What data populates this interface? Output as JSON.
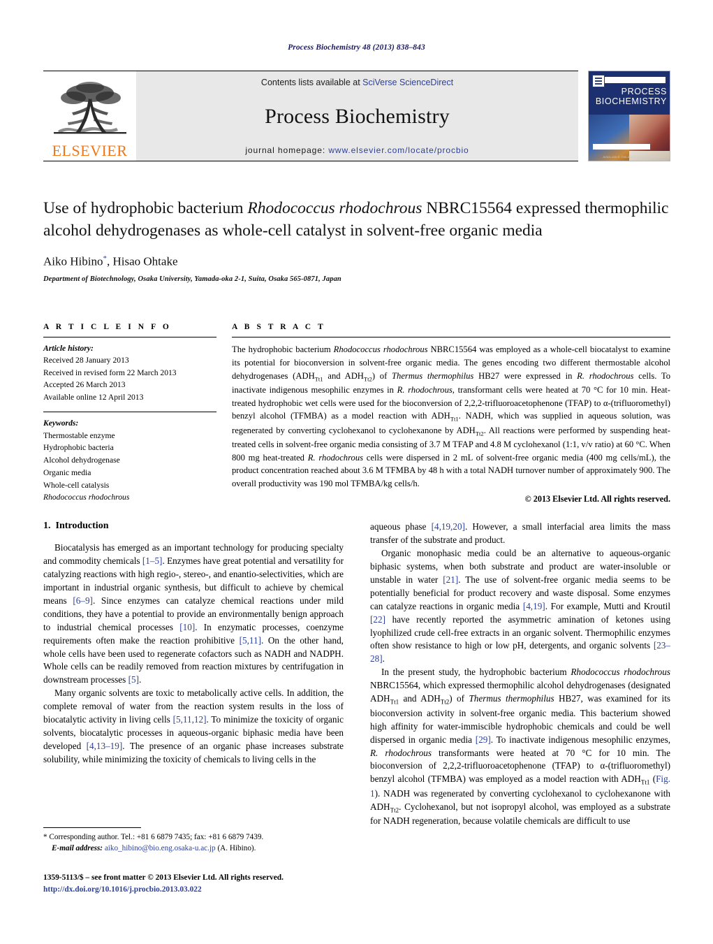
{
  "running_head": "Process Biochemistry 48 (2013) 838–843",
  "masthead": {
    "elsevier_wordmark": "ELSEVIER",
    "contents_prefix": "Contents lists available at ",
    "sciencedirect_link": "SciVerse ScienceDirect",
    "journal_title": "Process Biochemistry",
    "homepage_prefix": "journal homepage: ",
    "homepage_url": "www.elsevier.com/locate/procbio",
    "cover_title_line1": "PROCESS",
    "cover_title_line2": "BIOCHEMISTRY",
    "cover_footer": "AVAILABLE ONLINE AT SCIENCEDIRECT"
  },
  "article": {
    "title_part1": "Use of hydrophobic bacterium ",
    "title_species": "Rhodococcus rhodochrous",
    "title_part2": " NBRC15564 expressed thermophilic alcohol dehydrogenases as whole-cell catalyst in solvent-free organic media",
    "authors": "Aiko Hibino",
    "author_marker": "*",
    "authors_rest": ", Hisao Ohtake",
    "affiliation": "Department of Biotechnology, Osaka University, Yamada-oka 2-1, Suita, Osaka 565-0871, Japan"
  },
  "article_info": {
    "heading": "A R T I C L E  I N F O",
    "history_label": "Article history:",
    "history": [
      "Received 28 January 2013",
      "Received in revised form 22 March 2013",
      "Accepted 26 March 2013",
      "Available online 12 April 2013"
    ],
    "keywords_label": "Keywords:",
    "keywords": [
      "Thermostable enzyme",
      "Hydrophobic bacteria",
      "Alcohol dehydrogenase",
      "Organic media",
      "Whole-cell catalysis"
    ],
    "keyword_italic": "Rhodococcus rhodochrous"
  },
  "abstract": {
    "heading": "A B S T R A C T",
    "p1": "The hydrophobic bacterium ",
    "sp1": "Rhodococcus rhodochrous",
    "p2": " NBRC15564 was employed as a whole-cell biocatalyst to examine its potential for bioconversion in solvent-free organic media. The genes encoding two different thermostable alcohol dehydrogenases (ADH",
    "sub1": "Tt1",
    "p3": " and ADH",
    "sub2": "Tt2",
    "p4": ") of ",
    "sp2": "Thermus thermophilus",
    "p5": " HB27 were expressed in ",
    "sp3": "R. rhodochrous",
    "p6": " cells. To inactivate indigenous mesophilic enzymes in ",
    "sp4": "R. rhodochrous",
    "p7": ", transformant cells were heated at 70 °C for 10 min. Heat-treated hydrophobic wet cells were used for the bioconversion of 2,2,2-trifluoroacetophenone (TFAP) to α-(trifluoromethyl) benzyl alcohol (TFMBA) as a model reaction with ADH",
    "sub3": "Tt1",
    "p8": ". NADH, which was supplied in aqueous solution, was regenerated by converting cyclohexanol to cyclohexanone by ADH",
    "sub4": "Tt2",
    "p9": ". All reactions were performed by suspending heat-treated cells in solvent-free organic media consisting of 3.7 M TFAP and 4.8 M cyclohexanol (1:1, v/v ratio) at 60 °C. When 800 mg heat-treated ",
    "sp5": "R. rhodochrous",
    "p10": " cells were dispersed in 2 mL of solvent-free organic media (400 mg cells/mL), the product concentration reached about 3.6 M TFMBA by 48 h with a total NADH turnover number of approximately 900. The overall productivity was 190 mol TFMBA/kg cells/h.",
    "copyright": "© 2013 Elsevier Ltd. All rights reserved."
  },
  "introduction": {
    "number": "1.",
    "title": "Introduction",
    "left_p1_a": "Biocatalysis has emerged as an important technology for producing specialty and commodity chemicals ",
    "left_p1_r1": "[1–5]",
    "left_p1_b": ". Enzymes have great potential and versatility for catalyzing reactions with high regio-, stereo-, and enantio-selectivities, which are important in industrial organic synthesis, but difficult to achieve by chemical means ",
    "left_p1_r2": "[6–9]",
    "left_p1_c": ". Since enzymes can catalyze chemical reactions under mild conditions, they have a potential to provide an environmentally benign approach to industrial chemical processes ",
    "left_p1_r3": "[10]",
    "left_p1_d": ". In enzymatic processes, coenzyme requirements often make the reaction prohibitive ",
    "left_p1_r4": "[5,11]",
    "left_p1_e": ". On the other hand, whole cells have been used to regenerate cofactors such as NADH and NADPH. Whole cells can be readily removed from reaction mixtures by centrifugation in downstream processes ",
    "left_p1_r5": "[5]",
    "left_p1_f": ".",
    "left_p2_a": "Many organic solvents are toxic to metabolically active cells. In addition, the complete removal of water from the reaction system results in the loss of biocatalytic activity in living cells ",
    "left_p2_r1": "[5,11,12]",
    "left_p2_b": ". To minimize the toxicity of organic solvents, biocatalytic processes in aqueous-organic biphasic media have been developed ",
    "left_p2_r2": "[4,13–19]",
    "left_p2_c": ". The presence of an organic phase increases substrate solubility, while minimizing the toxicity of chemicals to living cells in the",
    "right_p1_a": "aqueous phase ",
    "right_p1_r1": "[4,19,20]",
    "right_p1_b": ". However, a small interfacial area limits the mass transfer of the substrate and product.",
    "right_p2_a": "Organic monophasic media could be an alternative to aqueous-organic biphasic systems, when both substrate and product are water-insoluble or unstable in water ",
    "right_p2_r1": "[21]",
    "right_p2_b": ". The use of solvent-free organic media seems to be potentially beneficial for product recovery and waste disposal. Some enzymes can catalyze reactions in organic media ",
    "right_p2_r2": "[4,19]",
    "right_p2_c": ". For example, Mutti and Kroutil ",
    "right_p2_r3": "[22]",
    "right_p2_d": " have recently reported the asymmetric amination of ketones using lyophilized crude cell-free extracts in an organic solvent. Thermophilic enzymes often show resistance to high or low pH, detergents, and organic solvents ",
    "right_p2_r4": "[23–28]",
    "right_p2_e": ".",
    "right_p3_a": "In the present study, the hydrophobic bacterium ",
    "right_p3_sp1": "Rhodococcus rhodochrous",
    "right_p3_b": " NBRC15564, which expressed thermophilic alcohol dehydrogenases (designated ADH",
    "right_p3_sub1": "Tt1",
    "right_p3_c": " and ADH",
    "right_p3_sub2": "Tt2",
    "right_p3_d": ") of ",
    "right_p3_sp2": "Thermus thermophilus",
    "right_p3_e": " HB27, was examined for its bioconversion activity in solvent-free organic media. This bacterium showed high affinity for water-immiscible hydrophobic chemicals and could be well dispersed in organic media ",
    "right_p3_r1": "[29]",
    "right_p3_f": ". To inactivate indigenous mesophilic enzymes, ",
    "right_p3_sp3": "R. rhodochrous",
    "right_p3_g": " transformants were heated at 70 °C for 10 min. The bioconversion of 2,2,2-trifluoroacetophenone (TFAP) to α-(trifluoromethyl) benzyl alcohol (TFMBA) was employed as a model reaction with ADH",
    "right_p3_sub3": "Tt1",
    "right_p3_h": " (",
    "right_p3_fig": "Fig. 1",
    "right_p3_i": "). NADH was regenerated by converting cyclohexanol to cyclohexanone with ADH",
    "right_p3_sub4": "Tt2",
    "right_p3_j": ". Cyclohexanol, but not isopropyl alcohol, was employed as a substrate for NADH regeneration, because volatile chemicals are difficult to use"
  },
  "footnote": {
    "star": "*",
    "corresponding": " Corresponding author. Tel.: +81 6 6879 7435; fax: +81 6 6879 7439.",
    "email_label": "E-mail address:",
    "email": "aiko_hibino@bio.eng.osaka-u.ac.jp",
    "email_suffix": " (A. Hibino)."
  },
  "footer": {
    "issn_line": "1359-5113/$ – see front matter © 2013 Elsevier Ltd. All rights reserved.",
    "doi": "http://dx.doi.org/10.1016/j.procbio.2013.03.022"
  }
}
